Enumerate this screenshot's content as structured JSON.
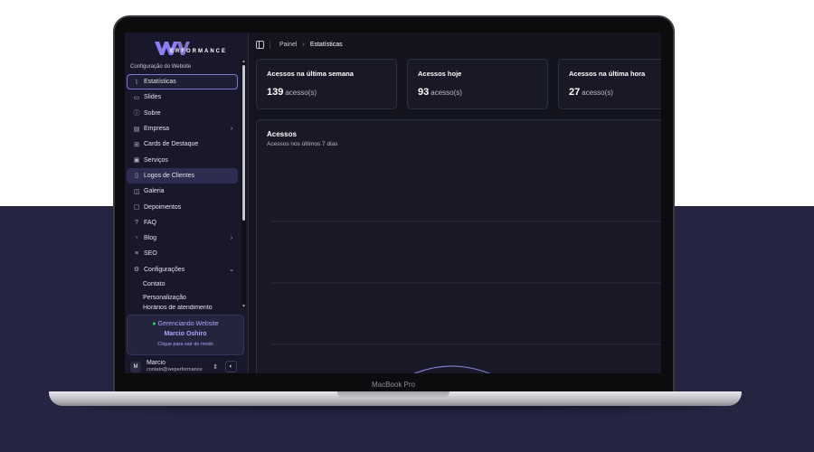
{
  "device": {
    "label": "MacBook Pro"
  },
  "brand": {
    "logo_text": "ERFORMANCE"
  },
  "sidebar": {
    "section_title": "Configuração do Website",
    "items": [
      {
        "label": "Estatísticas",
        "icon": "chart-icon",
        "state": "active"
      },
      {
        "label": "Slides",
        "icon": "slides-icon"
      },
      {
        "label": "Sobre",
        "icon": "info-icon"
      },
      {
        "label": "Empresa",
        "icon": "building-icon",
        "chevron": "›"
      },
      {
        "label": "Cards de Destaque",
        "icon": "grid-icon"
      },
      {
        "label": "Serviços",
        "icon": "briefcase-icon"
      },
      {
        "label": "Logos de Clientes",
        "icon": "logo-icon",
        "state": "highlight"
      },
      {
        "label": "Galeria",
        "icon": "gallery-icon"
      },
      {
        "label": "Depoimentos",
        "icon": "message-icon"
      },
      {
        "label": "FAQ",
        "icon": "help-icon"
      },
      {
        "label": "Blog",
        "icon": "rss-icon",
        "chevron": "›"
      },
      {
        "label": "SEO",
        "icon": "seo-icon"
      },
      {
        "label": "Configurações",
        "icon": "settings-icon",
        "chevron": "⌄"
      }
    ],
    "sub_items": [
      "Contato",
      "Personalização",
      "Horários de atendimento"
    ],
    "manage": {
      "title": "Gerenciando Website",
      "user": "Marcio Oshiro",
      "exit": "Clique para sair do modo"
    },
    "user": {
      "initial": "M",
      "name": "Marcio",
      "email": "contato@weperformance"
    }
  },
  "breadcrumb": {
    "root": "Painel",
    "current": "Estatísticas"
  },
  "cards": [
    {
      "title": "Acessos na última semana",
      "value": "139",
      "unit": "acesso(s)"
    },
    {
      "title": "Acessos hoje",
      "value": "93",
      "unit": "acesso(s)"
    },
    {
      "title": "Acessos na última hora",
      "value": "27",
      "unit": "acesso(s)"
    }
  ],
  "chart": {
    "title": "Acessos",
    "subtitle": "Acessos nos últimos 7 dias"
  },
  "colors": {
    "accent": "#a8a6ff",
    "background": "#252542",
    "status": "#35d06a"
  }
}
